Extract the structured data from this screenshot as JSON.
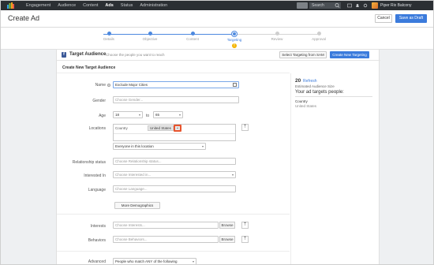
{
  "topnav": {
    "links": [
      "Engagement",
      "Audience",
      "Content",
      "Ads",
      "Status",
      "Administration"
    ],
    "active": "Ads",
    "search_label": "Search",
    "brand": "Piper Rix Balcony"
  },
  "header": {
    "title": "Create Ad",
    "cancel_label": "Cancel",
    "draft_label": "Save as Draft"
  },
  "stepper": {
    "steps": [
      "Details",
      "Objective",
      "Content",
      "Targeting",
      "Review",
      "Approval"
    ],
    "current": "Targeting"
  },
  "targeting": {
    "title": "Target Audience",
    "subtitle": "Choose the people you want to reach",
    "sam_button": "Select Targeting from SAM",
    "new_button": "Create New Targeting",
    "section_label": "Create New Target Audience"
  },
  "form": {
    "name_label": "Name",
    "name_value": "Exclude Major Cities",
    "gender_label": "Gender",
    "gender_placeholder": "Choose Gender...",
    "age_label": "Age",
    "age_from": "18",
    "age_to_label": "to",
    "age_to": "65",
    "locations_label": "Locations",
    "country_label": "Country",
    "country_value": "United States",
    "location_mode": "Everyone in this location",
    "relationship_label": "Relationship status",
    "relationship_placeholder": "Choose Relationship status...",
    "interested_label": "Interested In",
    "interested_placeholder": "Choose Interested in...",
    "language_label": "Language",
    "language_placeholder": "Choose Language...",
    "more_demographics": "More Demographics",
    "interests_label": "Interests",
    "interests_placeholder": "Choose Interests...",
    "behaviors_label": "Behaviors",
    "behaviors_placeholder": "Choose Behaviors...",
    "browse_label": "Browse",
    "advanced_label": "Advanced",
    "advanced_value": "People who match ANY of the following"
  },
  "audience_panel": {
    "count": "20",
    "refresh_label": "Refresh",
    "size_label": "Estimated Audience Size",
    "heading": "Your ad targets people:",
    "country_label": "Country",
    "country_value": "United States"
  },
  "colors": {
    "primary": "#3b7bdc",
    "nav_bg": "#2b2f33",
    "highlight": "#e8542d",
    "warning": "#f4b400"
  }
}
